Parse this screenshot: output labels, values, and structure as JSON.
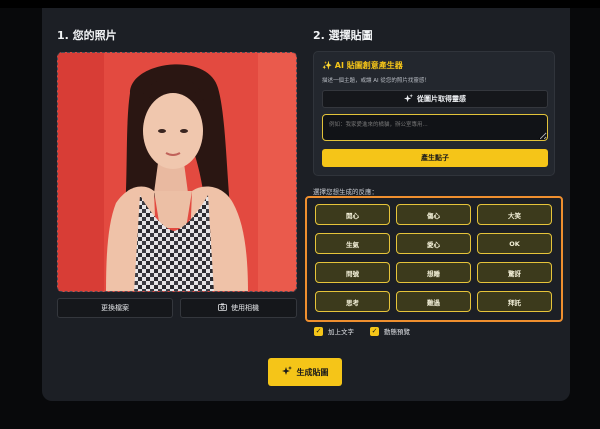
{
  "left": {
    "title": "1. 您的照片",
    "replace_file_label": "更換檔案",
    "use_camera_label": "使用相機"
  },
  "right": {
    "title": "2. 選擇貼圖",
    "ai_card": {
      "title": "✨ AI 貼圖創意產生器",
      "description": "描述一個主題，或讓 AI 從您的照片找靈感！",
      "inspire_label": "從圖片取得靈感",
      "input_placeholder": "例如：我家愛進來的橘貓，辦公室專用...",
      "generate_ideas_label": "產生點子"
    },
    "reaction_label": "選擇您想生成的反應：",
    "reactions": [
      "開心",
      "傷心",
      "大笑",
      "生氣",
      "愛心",
      "OK",
      "問號",
      "想睡",
      "驚訝",
      "思考",
      "難過",
      "拜託"
    ],
    "options": [
      {
        "label": "加上文字",
        "checked": true
      },
      {
        "label": "動態預覽",
        "checked": true
      }
    ]
  },
  "generate_label": "生成貼圖",
  "colors": {
    "accent": "#f5c518",
    "highlight_border": "#ef8f2f",
    "panel_bg": "#1c1f25",
    "page_bg": "#08090b"
  }
}
